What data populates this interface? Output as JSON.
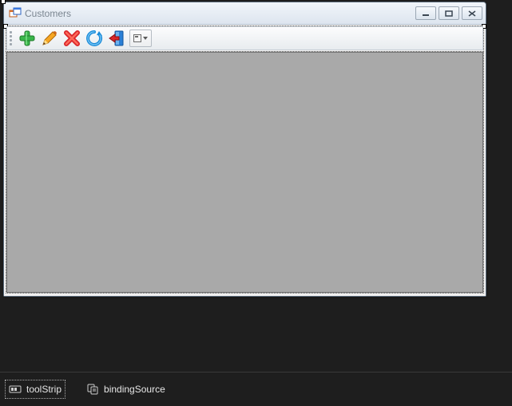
{
  "window": {
    "title": "Customers"
  },
  "toolbar": {
    "buttons": [
      {
        "name": "add"
      },
      {
        "name": "edit"
      },
      {
        "name": "delete"
      },
      {
        "name": "refresh"
      },
      {
        "name": "exit"
      }
    ]
  },
  "tray": {
    "items": [
      {
        "name": "toolStrip",
        "label": "toolStrip"
      },
      {
        "name": "bindingSource",
        "label": "bindingSource"
      }
    ]
  }
}
